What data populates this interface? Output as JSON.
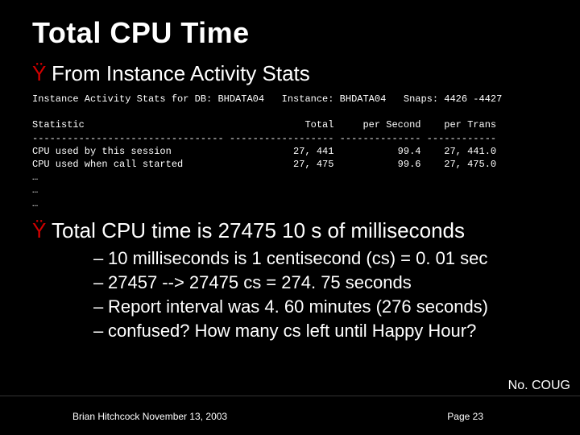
{
  "title": "Total CPU Time",
  "bullets": {
    "b1": "From Instance Activity Stats",
    "b2": "Total CPU time is 27475 10 s of milliseconds"
  },
  "sub": {
    "s1": "10 milliseconds is 1 centisecond (cs) = 0. 01 sec",
    "s2": "27457 --> 27475 cs = 274. 75 seconds",
    "s3": "Report interval was 4. 60 minutes (276 seconds)",
    "s4": "confused? How many cs left until Happy Hour?"
  },
  "stats": {
    "header": "Instance Activity Stats for DB: BHDATA04   Instance: BHDATA04   Snaps: 4426 -4427",
    "col_line": "Statistic                                      Total     per Second    per Trans",
    "dash_line": "--------------------------------- ------------------ -------------- ------------",
    "row1": "CPU used by this session                     27, 441           99.4    27, 441.0",
    "row2": "CPU used when call started                   27, 475           99.6    27, 475.0",
    "dots1": "…",
    "dots2": "…",
    "dots3": "…"
  },
  "footer": {
    "brand": "No. COUG",
    "author_date": "Brian Hitchcock  November 13, 2003",
    "page": "Page 23"
  },
  "chart_data": {
    "type": "table",
    "title": "Instance Activity Stats for DB: BHDATA04   Instance: BHDATA04   Snaps: 4426 -4427",
    "columns": [
      "Statistic",
      "Total",
      "per Second",
      "per Trans"
    ],
    "rows": [
      [
        "CPU used by this session",
        27441,
        99.4,
        27441.0
      ],
      [
        "CPU used when call started",
        27475,
        99.6,
        27475.0
      ]
    ]
  }
}
